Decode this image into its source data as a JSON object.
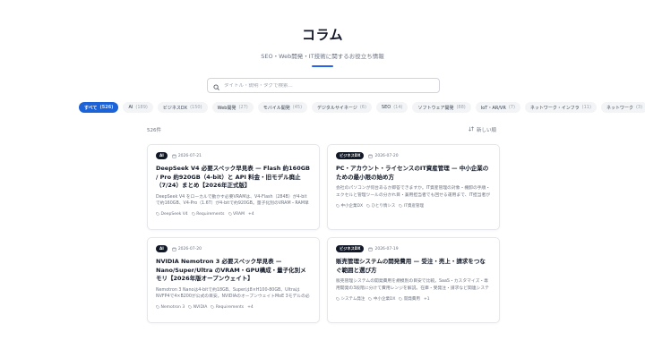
{
  "header": {
    "title": "コラム",
    "subtitle": "SEO・Web開発・IT技術に関するお役立ち情報"
  },
  "search": {
    "placeholder": "タイトル・説明・タグで検索..."
  },
  "categories": [
    {
      "label": "すべて",
      "count": "(526)",
      "active": true
    },
    {
      "label": "AI",
      "count": "(189)"
    },
    {
      "label": "ビジネスDX",
      "count": "(150)"
    },
    {
      "label": "Web開発",
      "count": "(27)"
    },
    {
      "label": "モバイル開発",
      "count": "(45)"
    },
    {
      "label": "デジタルサイネージ",
      "count": "(6)"
    },
    {
      "label": "SEO",
      "count": "(14)"
    },
    {
      "label": "ソフトウェア開発",
      "count": "(88)"
    },
    {
      "label": "IoT・AR/VR",
      "count": "(7)"
    },
    {
      "label": "ネットワーク・インフラ",
      "count": "(11)"
    },
    {
      "label": "ネットワーク",
      "count": "(3)"
    }
  ],
  "results": {
    "count": "526件",
    "sort_label": "新しい順"
  },
  "articles": [
    {
      "badge": "AI",
      "date": "2026-07-21",
      "title": "DeepSeek V4 必要スペック早見表 — Flash 約160GB / Pro 約920GB（4-bit）と API 料金・旧モデル廃止（7/24）まとめ【2026年正式版】",
      "excerpt": "DeepSeek V4 をローカルで動かす必要VRAMは、V4-Flash（284B）が4-bitで約160GB、V4-Pro（1.6T）が4-bitで約920GB。量子化別のVRAM・RAM早見...",
      "tags": [
        "DeepSeek V4",
        "Requirements",
        "VRAM"
      ],
      "more": "+4"
    },
    {
      "badge": "ビジネスDX",
      "date": "2026-07-20",
      "title": "PC・アカウント・ライセンスのIT資産管理 — 中小企業のための最小限の始め方",
      "excerpt": "会社のパソコンが何台あるか即答できますか。IT資産管理の対象・棚卸の手順・エクセルと管理ツールの分かれ目・兼用担当者でも回せる運用まで、IT担当者がいない中小企業向けに...",
      "tags": [
        "中小企業DX",
        "ひとり情シス",
        "IT資産管理"
      ],
      "more": ""
    },
    {
      "badge": "AI",
      "date": "2026-07-20",
      "title": "NVIDIA Nemotron 3 必要スペック早見表 — Nano/Super/Ultra のVRAM・GPU構成・量子化別メモリ【2026年版オープンウェイト】",
      "excerpt": "Nemotron 3 Nanoは4-bitで約18GB、Superは8×H100-80GB、UltraはNVFP4で4×B200が公式の目安。NVIDIAのオープンウェイトMoE 3モデルの必要VRAM...",
      "tags": [
        "Nemotron 3",
        "NVIDIA",
        "Requirements"
      ],
      "more": "+4"
    },
    {
      "badge": "ビジネスDX",
      "date": "2026-07-19",
      "title": "販売管理システムの開発費用 — 受注・売上・請求をつなぐ範囲と選び方",
      "excerpt": "販売管理システムの開発費用を規模別の目安で比較。SaaS・カスタマイズ・専用開発の3段階に分けて費用レンジを解説。在庫・受発注・請求など関連システムとの関係、Excel運...",
      "tags": [
        "システム発注",
        "中小企業DX",
        "開発費用"
      ],
      "more": "+1"
    }
  ]
}
